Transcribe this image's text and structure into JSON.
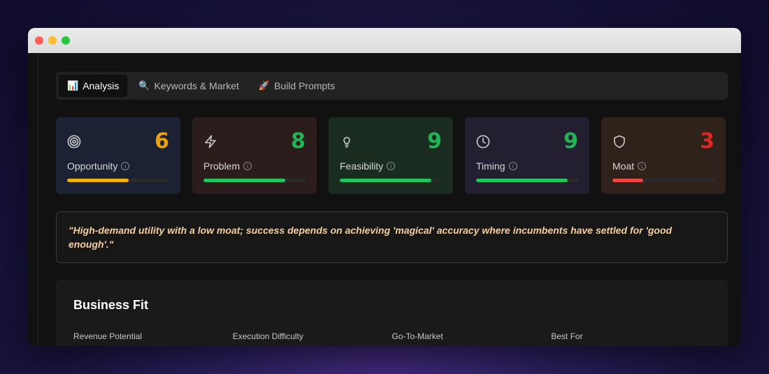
{
  "window": {
    "controls": [
      "close",
      "minimize",
      "maximize"
    ]
  },
  "tabs": [
    {
      "emoji": "📊",
      "label": "Analysis",
      "active": true
    },
    {
      "emoji": "🔍",
      "label": "Keywords & Market",
      "active": false
    },
    {
      "emoji": "🚀",
      "label": "Build Prompts",
      "active": false
    }
  ],
  "scores": [
    {
      "name": "Opportunity",
      "value": "6",
      "icon": "target-icon",
      "color": "#e8a20c",
      "bg": "#1c2233",
      "bar_color": "#f0b20a",
      "progress": 0.6
    },
    {
      "name": "Problem",
      "value": "8",
      "icon": "lightning-icon",
      "color": "#22b455",
      "bg": "#2a1d1c",
      "bar_color": "#22c55e",
      "progress": 0.8
    },
    {
      "name": "Feasibility",
      "value": "9",
      "icon": "lightbulb-icon",
      "color": "#22b455",
      "bg": "#1a2b20",
      "bar_color": "#22c55e",
      "progress": 0.9
    },
    {
      "name": "Timing",
      "value": "9",
      "icon": "clock-icon",
      "color": "#22b455",
      "bg": "#241f30",
      "bar_color": "#22c55e",
      "progress": 0.9
    },
    {
      "name": "Moat",
      "value": "3",
      "icon": "shield-icon",
      "color": "#dc2626",
      "bg": "#2e221b",
      "bar_color": "#ef4444",
      "progress": 0.3
    }
  ],
  "quote": "\"High-demand utility with a low moat; success depends on achieving 'magical' accuracy where incumbents have settled for 'good enough'.\"",
  "business_fit": {
    "title": "Business Fit",
    "columns": [
      "Revenue Potential",
      "Execution Difficulty",
      "Go-To-Market",
      "Best For"
    ]
  }
}
